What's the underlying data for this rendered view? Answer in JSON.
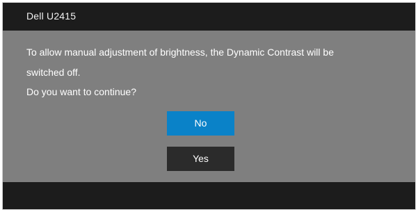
{
  "dialog": {
    "title": "Dell U2415",
    "message_lines": [
      "To allow manual adjustment of brightness, the Dynamic Contrast will be",
      "switched off.",
      "Do you want to continue?"
    ],
    "buttons": {
      "no_label": "No",
      "yes_label": "Yes",
      "selected": "No"
    }
  },
  "colors": {
    "title_bar": "#1c1c1c",
    "body": "#7f7f7f",
    "selected_button": "#0a82c8",
    "button": "#2b2b2b",
    "text": "#ffffff"
  }
}
